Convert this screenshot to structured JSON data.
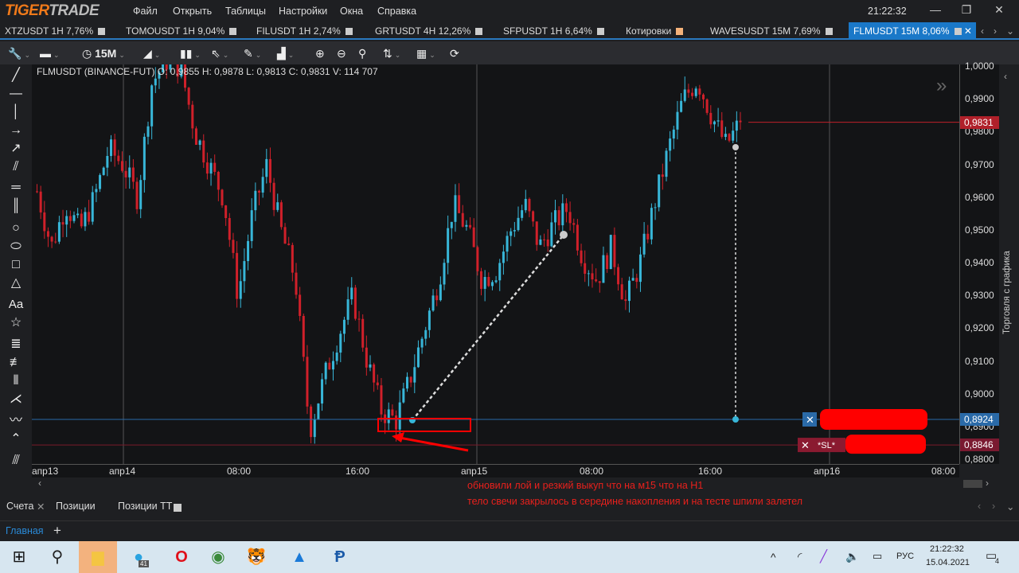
{
  "app": {
    "logo_a": "TIGER",
    "logo_b": "TRADE",
    "menu": [
      "Файл",
      "Открыть",
      "Таблицы",
      "Настройки",
      "Окна",
      "Справка"
    ],
    "clock": "21:22:32"
  },
  "tabs": [
    {
      "label": "XTZUSDT 1H  7,76%"
    },
    {
      "label": "TOMOUSDT 1H  9,04%"
    },
    {
      "label": "FILUSDT 1H  2,74%"
    },
    {
      "label": "GRTUSDT 4H  12,26%"
    },
    {
      "label": "SFPUSDT 1H  6,64%"
    },
    {
      "label": "Котировки"
    },
    {
      "label": "WAVESUSDT 15M  7,69%"
    },
    {
      "label": "FLMUSDT 15M  8,06%",
      "active": true
    }
  ],
  "toolbar": {
    "timeframe": "15M"
  },
  "chart": {
    "ohlc": "FLMUSDT (BINANCE-FUT) O: 0,9855  H: 0,9878  L: 0,9813  C: 0,9831  V: 114 707",
    "price_labels": [
      "1,0000",
      "0,9900",
      "0,9800",
      "0,9700",
      "0,9600",
      "0,9500",
      "0,9400",
      "0,9300",
      "0,9200",
      "0,9100",
      "0,9000",
      "0,8900",
      "0,8800"
    ],
    "price_values": [
      1.0,
      0.99,
      0.98,
      0.97,
      0.96,
      0.95,
      0.94,
      0.93,
      0.92,
      0.91,
      0.9,
      0.89,
      0.88
    ],
    "last_price": "0,9831",
    "last_price_value": 0.9831,
    "order_price": "0,8924",
    "order_price_value": 0.8924,
    "sl_price": "0,8846",
    "sl_price_value": 0.8846,
    "sl_label": "*SL*",
    "time_labels": [
      "апр13",
      "апр14",
      "08:00",
      "16:00",
      "апр15",
      "08:00",
      "16:00",
      "апр16",
      "08:00"
    ],
    "price_path": [
      0.962,
      0.945,
      0.958,
      0.95,
      0.96,
      0.975,
      0.97,
      0.96,
      0.995,
      1.002,
      1.0,
      0.98,
      0.97,
      0.96,
      0.93,
      0.955,
      0.97,
      0.95,
      0.935,
      0.889,
      0.905,
      0.918,
      0.93,
      0.91,
      0.895,
      0.892,
      0.905,
      0.92,
      0.935,
      0.958,
      0.95,
      0.935,
      0.938,
      0.95,
      0.958,
      0.945,
      0.952,
      0.957,
      0.942,
      0.935,
      0.945,
      0.928,
      0.94,
      0.958,
      0.975,
      0.99,
      0.996,
      0.985,
      0.976,
      0.9831
    ],
    "side_label": "Торговля с графика",
    "note_line1": "обновили лой и резкий выкуп что на м15 что на Н1",
    "note_line2": "тело свечи закрылось в середине накопления и на тесте шпили залетел",
    "colors": {
      "bull": "#38b6d8",
      "bear": "#d0202a",
      "order": "#2a6aa8",
      "sl": "#8a1a30",
      "annotation": "#ff0000"
    }
  },
  "bottom": {
    "tabs": [
      "Счета",
      "Позиции",
      "Позиции ТТ"
    ],
    "workspace": "Главная",
    "add": "+"
  },
  "taskbar": {
    "lang": "РУС",
    "time": "21:22:32",
    "date": "15.04.2021",
    "telegram_badge": "41",
    "notif": "4"
  }
}
